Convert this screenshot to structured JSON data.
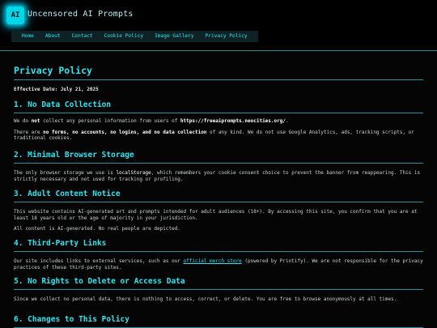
{
  "header": {
    "logo_text": "AI",
    "site_title": "Uncensored AI Prompts"
  },
  "nav": {
    "items": [
      {
        "label": "Home"
      },
      {
        "label": "About"
      },
      {
        "label": "Contact"
      },
      {
        "label": "Cookie Policy"
      },
      {
        "label": "Image Gallery"
      },
      {
        "label": "Privacy Policy"
      }
    ]
  },
  "page": {
    "title": "Privacy Policy",
    "effective_date": "Effective Date: July 21, 2025"
  },
  "sections": [
    {
      "heading": "1. No Data Collection",
      "p1_pre": "We do ",
      "p1_bold1": "not",
      "p1_mid": " collect any personal information from users of ",
      "p1_bold2": "https://freeaiprompts.neocities.org/",
      "p1_post": ".",
      "p2_pre": "There are ",
      "p2_bold": "no forms, no accounts, no logins, and no data collection",
      "p2_post": " of any kind. We do not use Google Analytics, ads, tracking scripts, or traditional cookies."
    },
    {
      "heading": "2. Minimal Browser Storage",
      "p1_pre": "The only browser storage we use is ",
      "p1_code": "localStorage",
      "p1_post": ", which remembers your cookie consent choice to prevent the banner from reappearing. This is strictly necessary and not used for tracking or profiling."
    },
    {
      "heading": "3. Adult Content Notice",
      "p1": "This website contains AI-generated art and prompts intended for adult audiences (18+). By accessing this site, you confirm that you are at least 18 years old or the age of majority in your jurisdiction.",
      "p2": "All content is AI-generated. No real people are depicted."
    },
    {
      "heading": "4. Third-Party Links",
      "p1_pre": "Our site includes links to external services, such as our ",
      "p1_link": "official merch store",
      "p1_post": " (powered by Printify). We are not responsible for the privacy practices of these third-party sites."
    },
    {
      "heading": "5. No Rights to Delete or Access Data",
      "p1": "Since we collect no personal data, there is nothing to access, correct, or delete. You are free to browse anonymously at all times."
    },
    {
      "heading": "6. Changes to This Policy"
    }
  ],
  "colors": {
    "accent": "#2ee6f2",
    "background": "#050505",
    "rule": "#1f8f98"
  }
}
